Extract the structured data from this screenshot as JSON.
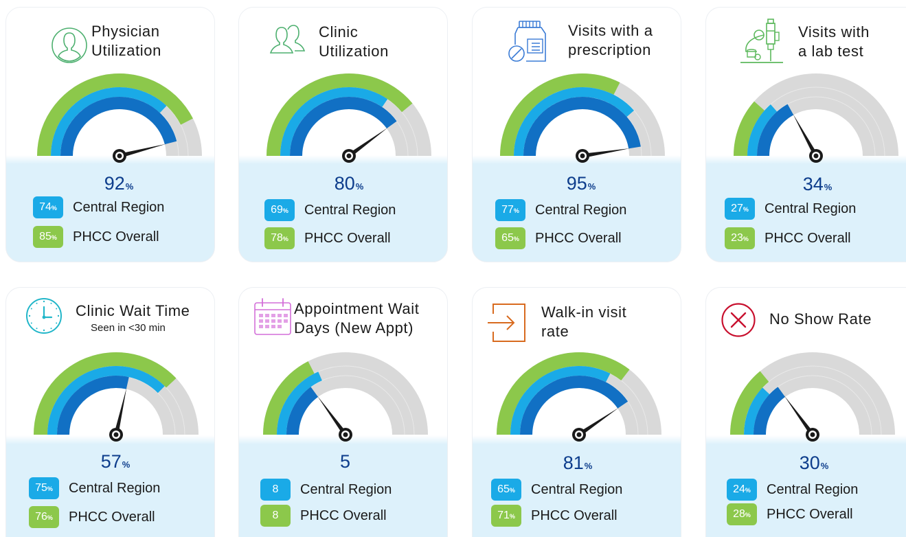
{
  "cards": [
    {
      "id": "physician-utilization",
      "title_lines": [
        "Physician",
        "Utilization"
      ],
      "icon": "person-icon",
      "value": 92,
      "unit": "%",
      "central_region": {
        "label": "Central Region",
        "value": 74,
        "unit": "%"
      },
      "phcc_overall": {
        "label": "PHCC Overall",
        "value": 85,
        "unit": "%"
      }
    },
    {
      "id": "clinic-utilization",
      "title_lines": [
        "Clinic",
        "Utilization"
      ],
      "icon": "group-icon",
      "value": 80,
      "unit": "%",
      "central_region": {
        "label": "Central Region",
        "value": 69,
        "unit": "%"
      },
      "phcc_overall": {
        "label": "PHCC Overall",
        "value": 78,
        "unit": "%"
      }
    },
    {
      "id": "visits-prescription",
      "title_lines": [
        "Visits with a",
        "prescription"
      ],
      "icon": "prescription-bottle-icon",
      "value": 95,
      "unit": "%",
      "central_region": {
        "label": "Central Region",
        "value": 77,
        "unit": "%"
      },
      "phcc_overall": {
        "label": "PHCC Overall",
        "value": 65,
        "unit": "%"
      }
    },
    {
      "id": "visits-lab-test",
      "title_lines": [
        "Visits with",
        "a lab test"
      ],
      "icon": "microscope-icon",
      "value": 34,
      "unit": "%",
      "central_region": {
        "label": "Central Region",
        "value": 27,
        "unit": "%"
      },
      "phcc_overall": {
        "label": "PHCC Overall",
        "value": 23,
        "unit": "%"
      }
    },
    {
      "id": "clinic-wait-time",
      "title_lines": [
        "Clinic Wait Time"
      ],
      "subtitle": "Seen in <30 min",
      "icon": "clock-icon",
      "value": 57,
      "unit": "%",
      "central_region": {
        "label": "Central Region",
        "value": 75,
        "unit": "%"
      },
      "phcc_overall": {
        "label": "PHCC Overall",
        "value": 76,
        "unit": "%"
      }
    },
    {
      "id": "appointment-wait-days",
      "title_lines": [
        "Appointment Wait",
        "Days (New Appt)"
      ],
      "icon": "calendar-icon",
      "value": 5,
      "unit": "",
      "central_region": {
        "label": "Central Region",
        "value": 8,
        "unit": ""
      },
      "phcc_overall": {
        "label": "PHCC Overall",
        "value": 8,
        "unit": ""
      }
    },
    {
      "id": "walk-in-visit-rate",
      "title_lines": [
        "Walk-in visit",
        "rate"
      ],
      "icon": "sign-in-icon",
      "value": 81,
      "unit": "%",
      "central_region": {
        "label": "Central Region",
        "value": 65,
        "unit": "%"
      },
      "phcc_overall": {
        "label": "PHCC Overall",
        "value": 71,
        "unit": "%"
      }
    },
    {
      "id": "no-show-rate",
      "title_lines": [
        "No Show Rate"
      ],
      "icon": "cancel-circle-icon",
      "value": 30,
      "unit": "%",
      "central_region": {
        "label": "Central Region",
        "value": 24,
        "unit": "%"
      },
      "phcc_overall": {
        "label": "PHCC Overall",
        "value": 28,
        "unit": "%"
      }
    }
  ],
  "colors": {
    "overall_arc": "#8cc84b",
    "central_arc": "#1aaae7",
    "main_arc": "#1170c4",
    "track": "#d9d9d9",
    "needle": "#1a1a1a",
    "value_text": "#0d3d8c"
  },
  "gauge_fill": [
    {
      "main": 0.92,
      "central": 0.74,
      "overall": 0.85
    },
    {
      "main": 0.8,
      "central": 0.69,
      "overall": 0.78
    },
    {
      "main": 0.95,
      "central": 0.77,
      "overall": 0.65
    },
    {
      "main": 0.34,
      "central": 0.27,
      "overall": 0.23
    },
    {
      "main": 0.57,
      "central": 0.75,
      "overall": 0.76
    },
    {
      "main": 0.3,
      "central": 0.37,
      "overall": 0.35
    },
    {
      "main": 0.81,
      "central": 0.65,
      "overall": 0.71
    },
    {
      "main": 0.3,
      "central": 0.24,
      "overall": 0.28
    }
  ]
}
